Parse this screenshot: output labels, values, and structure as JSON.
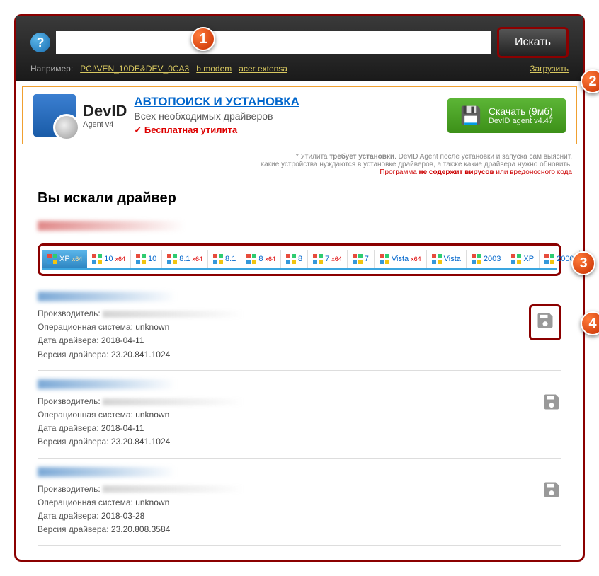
{
  "header": {
    "search_value": "",
    "search_button": "Искать",
    "example_label": "Например:",
    "example_links": [
      "PCI\\VEN_10DE&DEV_0CA3",
      "b modem",
      "acer extensa"
    ],
    "download_link": "Загрузить"
  },
  "promo": {
    "brand": "DevID",
    "agent": "Agent v4",
    "title": "АВТОПОИСК И УСТАНОВКА",
    "subtitle": "Всех необходимых драйверов",
    "free": "Бесплатная утилита",
    "download_label": "Скачать (9мб)",
    "download_sub": "DevID agent v4.47",
    "notes_line1_a": "* Утилита ",
    "notes_line1_b": "требует установки",
    "notes_line1_c": ". DevID Agent после установки и запуска сам выяснит,",
    "notes_line2": "какие устройства нуждаются в установке драйверов, а также какие драйвера нужно обновить.",
    "notes_line3_a": "Программа ",
    "notes_line3_b": "не содержит вирусов",
    "notes_line3_c": " или вредоносного кода"
  },
  "search_heading": "Вы искали драйвер",
  "os_tabs": [
    {
      "label": "XP",
      "x64": true,
      "active": true
    },
    {
      "label": "10",
      "x64": true
    },
    {
      "label": "10"
    },
    {
      "label": "8.1",
      "x64": true
    },
    {
      "label": "8.1"
    },
    {
      "label": "8",
      "x64": true
    },
    {
      "label": "8"
    },
    {
      "label": "7",
      "x64": true
    },
    {
      "label": "7"
    },
    {
      "label": "Vista",
      "x64": true
    },
    {
      "label": "Vista"
    },
    {
      "label": "2003"
    },
    {
      "label": "XP"
    },
    {
      "label": "2000"
    }
  ],
  "labels": {
    "manufacturer": "Производитель:",
    "os": "Операционная система:",
    "date": "Дата драйвера:",
    "version": "Версия драйвера:"
  },
  "drivers": [
    {
      "os": "unknown",
      "date": "2018-04-11",
      "version": "23.20.841.1024",
      "highlighted": true
    },
    {
      "os": "unknown",
      "date": "2018-04-11",
      "version": "23.20.841.1024"
    },
    {
      "os": "unknown",
      "date": "2018-03-28",
      "version": "23.20.808.3584"
    }
  ],
  "markers": [
    "1",
    "2",
    "3",
    "4"
  ]
}
